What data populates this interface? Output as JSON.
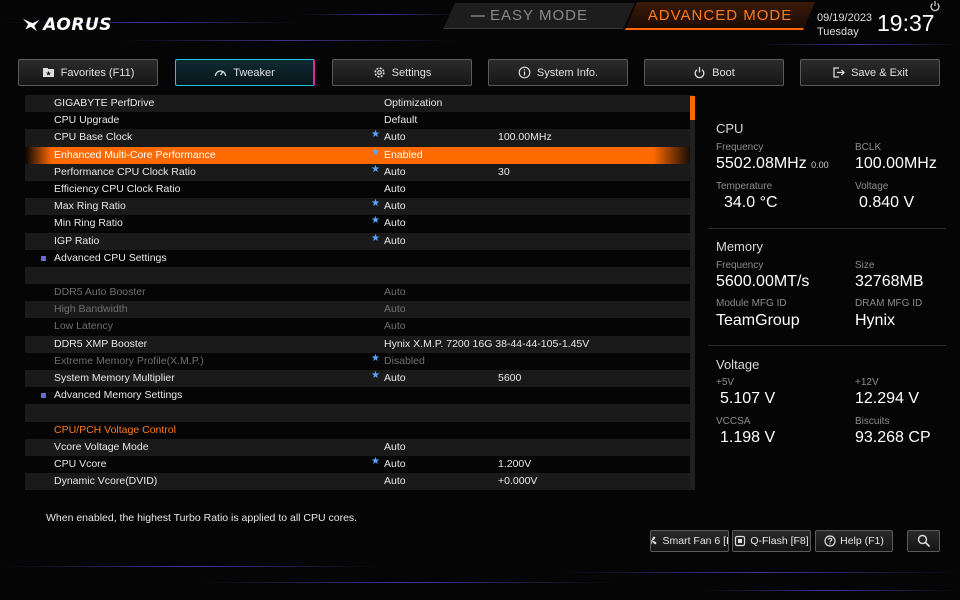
{
  "header": {
    "logo_text": "AORUS",
    "easy_mode": "EASY MODE",
    "advanced_mode": "ADVANCED MODE",
    "date": "09/19/2023",
    "weekday": "Tuesday",
    "time": "19:37"
  },
  "tabs": [
    {
      "label": "Favorites (F11)",
      "icon": "star-folder-icon",
      "active": false
    },
    {
      "label": "Tweaker",
      "icon": "gauge-icon",
      "active": true
    },
    {
      "label": "Settings",
      "icon": "gear-icon",
      "active": false
    },
    {
      "label": "System Info.",
      "icon": "info-icon",
      "active": false
    },
    {
      "label": "Boot",
      "icon": "power-icon",
      "active": false
    },
    {
      "label": "Save & Exit",
      "icon": "exit-icon",
      "active": false
    }
  ],
  "settings": [
    {
      "label": "GIGABYTE PerfDrive",
      "star": false,
      "v1": "Optimization",
      "v2": "",
      "state": "normal"
    },
    {
      "label": "CPU Upgrade",
      "star": false,
      "v1": "Default",
      "v2": "",
      "state": "normal"
    },
    {
      "label": "CPU Base Clock",
      "star": true,
      "v1": "Auto",
      "v2": "100.00MHz",
      "state": "normal"
    },
    {
      "label": "Enhanced Multi-Core Performance",
      "star": true,
      "v1": "Enabled",
      "v2": "",
      "state": "selected"
    },
    {
      "label": "Performance CPU Clock Ratio",
      "star": true,
      "v1": "Auto",
      "v2": "30",
      "state": "normal"
    },
    {
      "label": "Efficiency CPU Clock Ratio",
      "star": false,
      "v1": "Auto",
      "v2": "",
      "state": "normal"
    },
    {
      "label": "Max Ring Ratio",
      "star": true,
      "v1": "Auto",
      "v2": "",
      "state": "normal"
    },
    {
      "label": "Min Ring Ratio",
      "star": true,
      "v1": "Auto",
      "v2": "",
      "state": "normal"
    },
    {
      "label": "IGP Ratio",
      "star": true,
      "v1": "Auto",
      "v2": "",
      "state": "normal"
    },
    {
      "label": "Advanced CPU Settings",
      "star": false,
      "v1": "",
      "v2": "",
      "state": "submenu"
    },
    {
      "label": "",
      "star": false,
      "v1": "",
      "v2": "",
      "state": "blank"
    },
    {
      "label": "DDR5 Auto Booster",
      "star": false,
      "v1": "Auto",
      "v2": "",
      "state": "dim"
    },
    {
      "label": "High Bandwidth",
      "star": false,
      "v1": "Auto",
      "v2": "",
      "state": "dim"
    },
    {
      "label": "Low Latency",
      "star": false,
      "v1": "Auto",
      "v2": "",
      "state": "dim"
    },
    {
      "label": "DDR5 XMP Booster",
      "star": false,
      "v1": "Hynix X.M.P. 7200 16G 38-44-44-105-1.45V",
      "v2": "",
      "state": "normal"
    },
    {
      "label": "Extreme Memory Profile(X.M.P.)",
      "star": true,
      "v1": "Disabled",
      "v2": "",
      "state": "dim"
    },
    {
      "label": "System Memory Multiplier",
      "star": true,
      "v1": "Auto",
      "v2": "5600",
      "state": "normal"
    },
    {
      "label": "Advanced Memory Settings",
      "star": false,
      "v1": "",
      "v2": "",
      "state": "submenu"
    },
    {
      "label": "",
      "star": false,
      "v1": "",
      "v2": "",
      "state": "blank"
    },
    {
      "label": "CPU/PCH Voltage Control",
      "star": false,
      "v1": "",
      "v2": "",
      "state": "header"
    },
    {
      "label": "Vcore Voltage Mode",
      "star": false,
      "v1": "Auto",
      "v2": "",
      "state": "normal"
    },
    {
      "label": "CPU Vcore",
      "star": true,
      "v1": "Auto",
      "v2": "1.200V",
      "state": "normal"
    },
    {
      "label": "Dynamic Vcore(DVID)",
      "star": false,
      "v1": "Auto",
      "v2": "+0.000V",
      "state": "normal"
    }
  ],
  "info": {
    "cpu": {
      "title": "CPU",
      "freq_label": "Frequency",
      "freq_value": "5502.08MHz",
      "freq_sub": "0.00",
      "bclk_label": "BCLK",
      "bclk_value": "100.00MHz",
      "temp_label": "Temperature",
      "temp_value": "34.0 °C",
      "volt_label": "Voltage",
      "volt_value": "0.840 V"
    },
    "memory": {
      "title": "Memory",
      "freq_label": "Frequency",
      "freq_value": "5600.00MT/s",
      "size_label": "Size",
      "size_value": "32768MB",
      "module_label": "Module MFG ID",
      "module_value": "TeamGroup",
      "dram_label": "DRAM MFG ID",
      "dram_value": "Hynix"
    },
    "voltage": {
      "title": "Voltage",
      "v5_label": "+5V",
      "v5_value": "5.107 V",
      "v12_label": "+12V",
      "v12_value": "12.294 V",
      "vccsa_label": "VCCSA",
      "vccsa_value": "1.198 V",
      "biscuits_label": "Biscuits",
      "biscuits_value": "93.268 CP"
    }
  },
  "help_text": "When enabled, the highest Turbo Ratio is applied to all CPU cores.",
  "bottom_buttons": {
    "smart_fan": "Smart Fan 6 [F",
    "qflash": "Q-Flash [F8]",
    "help": "Help (F1)"
  },
  "colors": {
    "accent": "#ff6a00",
    "tab_active": "#1fc7d8",
    "star": "#57a7ff"
  }
}
